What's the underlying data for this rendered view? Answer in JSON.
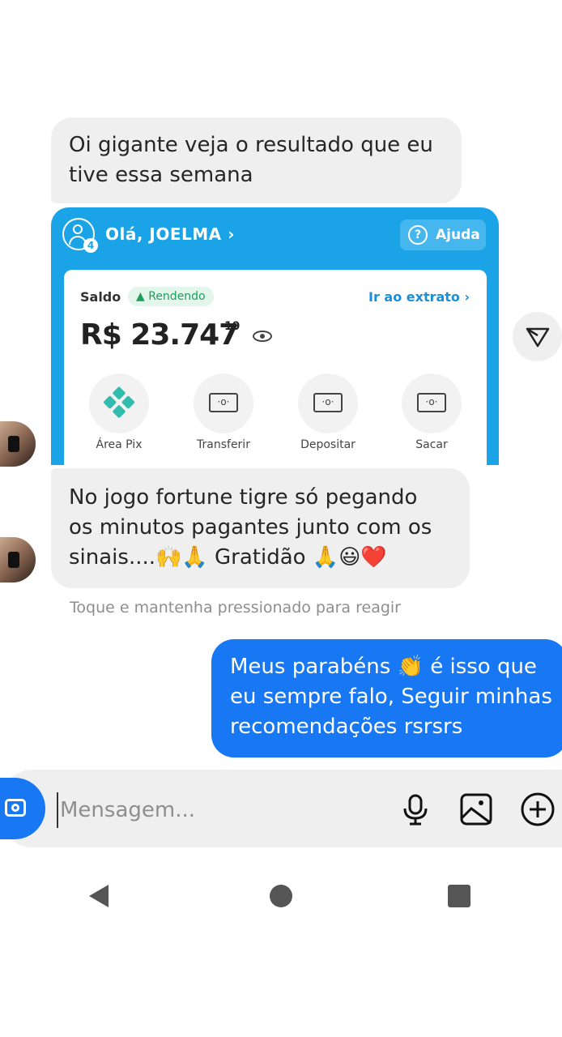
{
  "messages": {
    "incoming_1": {
      "lines": [
        "Oi gigante veja o resultado que eu",
        "tive essa semana"
      ]
    },
    "incoming_2": {
      "lines": [
        "No jogo fortune tigre só pegando",
        "os minutos pagantes junto com os",
        "sinais....🙌🙏 Gratidão 🙏😃❤️"
      ]
    },
    "hint": "Toque e mantenha pressionado para reagir",
    "outgoing_1": {
      "lines": [
        "Meus parabéns 👏 é isso que",
        "eu sempre falo, Seguir minhas",
        "recomendações rsrsrs"
      ]
    }
  },
  "bank_screenshot": {
    "badge_count": "4",
    "greeting": "Olá, JOELMA ›",
    "help_label": "Ajuda",
    "balance_label": "Saldo",
    "status_label": "▲ Rendendo",
    "statement_link": "Ir ao extrato ›",
    "amount": "R$ 23.747",
    "cents": "19",
    "actions": [
      "Área Pix",
      "Transferir",
      "Depositar",
      "Sacar"
    ]
  },
  "composer": {
    "placeholder": "Mensagem...",
    "icons": [
      "camera-icon",
      "microphone-icon",
      "image-icon",
      "plus-circle-icon"
    ]
  },
  "nav_icons": [
    "back-triangle-icon",
    "home-circle-icon",
    "recents-square-icon"
  ],
  "colors": {
    "outgoing": "#1877f2",
    "incoming": "#efefef",
    "bank_blue": "#1ba3e8",
    "pix_teal": "#32bcad"
  }
}
